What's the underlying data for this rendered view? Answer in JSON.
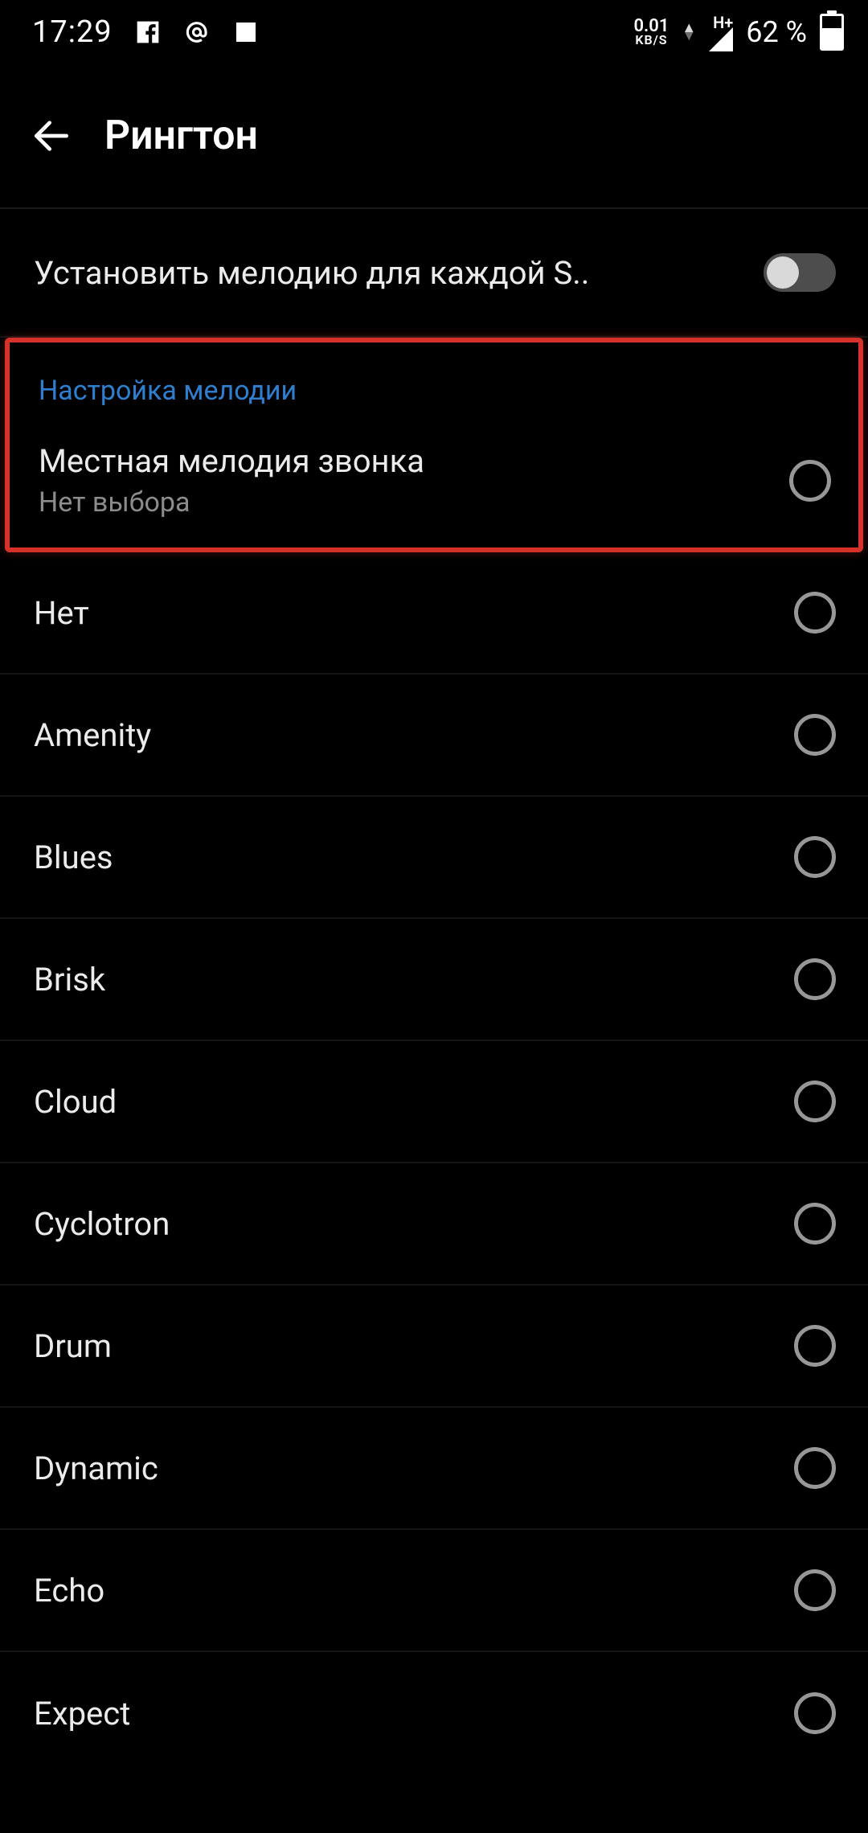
{
  "status": {
    "time": "17:29",
    "kbs_value": "0.01",
    "kbs_label": "KB/S",
    "network_label": "H+",
    "battery_pct": "62 %"
  },
  "header": {
    "title": "Рингтон"
  },
  "toggle_row": {
    "label": "Установить мелодию для каждой S..",
    "on": false
  },
  "section": {
    "title": "Настройка мелодии",
    "local": {
      "label": "Местная мелодия звонка",
      "sub": "Нет выбора"
    }
  },
  "ringtones": [
    {
      "label": "Нет"
    },
    {
      "label": "Amenity"
    },
    {
      "label": "Blues"
    },
    {
      "label": "Brisk"
    },
    {
      "label": "Cloud"
    },
    {
      "label": "Cyclotron"
    },
    {
      "label": "Drum"
    },
    {
      "label": "Dynamic"
    },
    {
      "label": "Echo"
    },
    {
      "label": "Expect"
    }
  ]
}
